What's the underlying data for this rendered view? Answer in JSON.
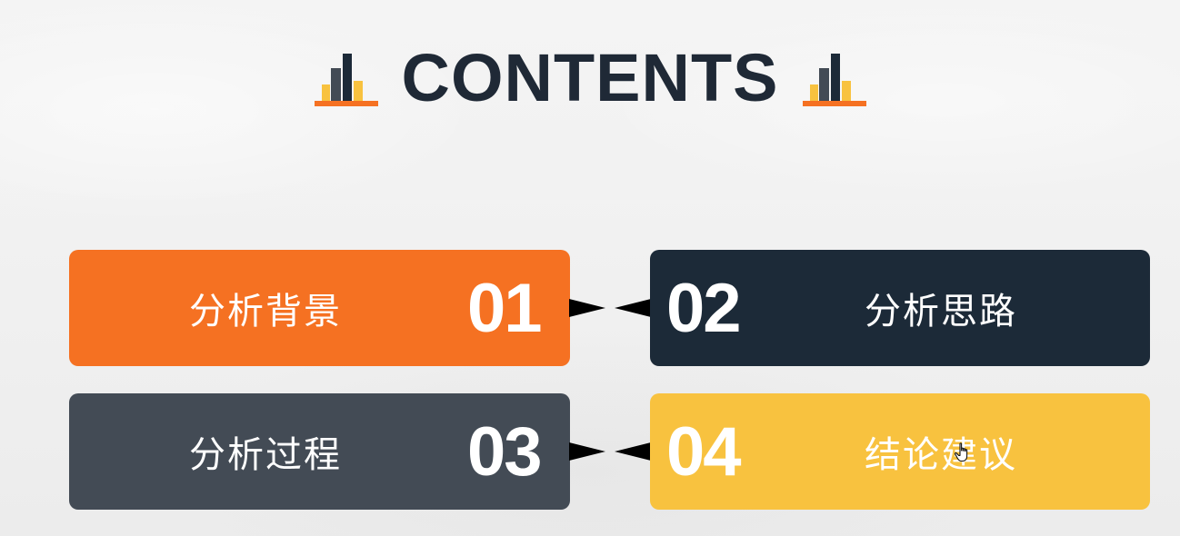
{
  "title": "CONTENTS",
  "icons": {
    "title_left": "bar-chart-icon",
    "title_right": "bar-chart-icon",
    "cursor": "hand-pointer-cursor-icon"
  },
  "colors": {
    "orange": "#f57122",
    "navy": "#1c2a38",
    "slate": "#434b55",
    "yellow": "#f8c23f",
    "title_text": "#1f2936"
  },
  "items": [
    {
      "number": "01",
      "label": "分析背景"
    },
    {
      "number": "02",
      "label": "分析思路"
    },
    {
      "number": "03",
      "label": "分析过程"
    },
    {
      "number": "04",
      "label": "结论建议"
    }
  ]
}
